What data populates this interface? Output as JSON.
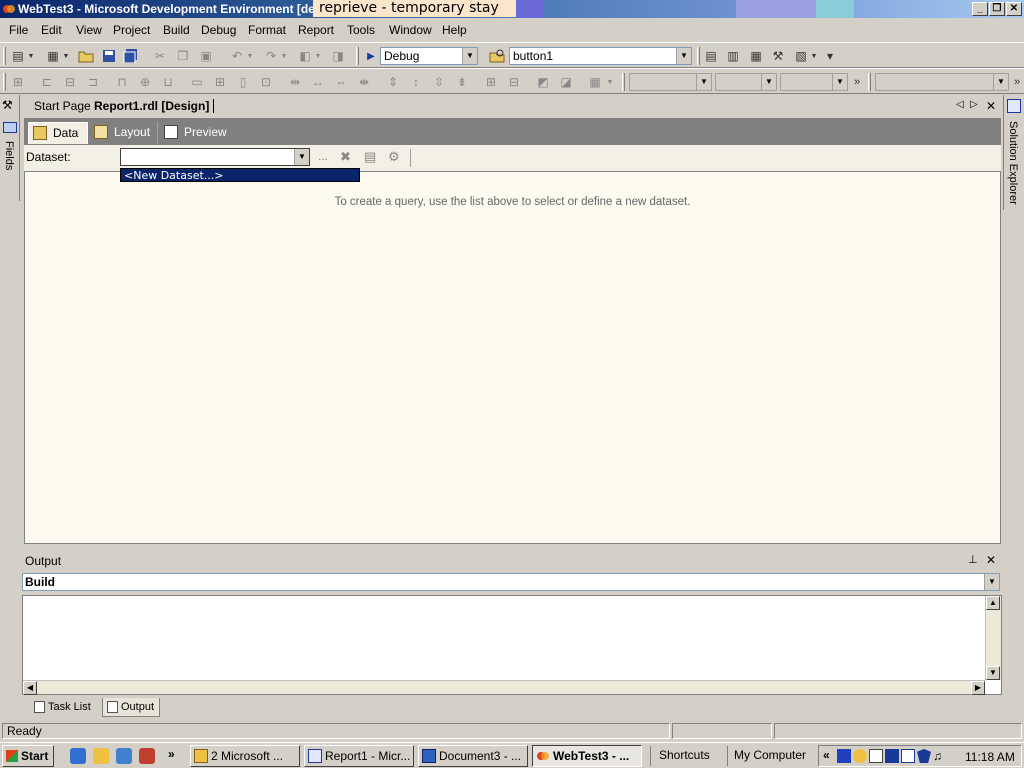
{
  "window": {
    "title": "WebTest3 - Microsoft Development Environment [de",
    "overlay_label": "reprieve - temporary stay",
    "controls": {
      "minimize": "_",
      "restore": "❐",
      "close": "✕"
    }
  },
  "menu": [
    "File",
    "Edit",
    "View",
    "Project",
    "Build",
    "Debug",
    "Format",
    "Report",
    "Tools",
    "Window",
    "Help"
  ],
  "toolbar": {
    "config": "Debug",
    "find_target": "button1",
    "overflow": "»"
  },
  "left_sidebar": {
    "label": "Fields",
    "icon": "toolbox-icon"
  },
  "right_sidebar": {
    "label": "Solution Explorer",
    "icon": "solution-explorer-icon"
  },
  "doc_tabs": [
    {
      "label": "Start Page"
    },
    {
      "label": "Report1.rdl [Design]"
    }
  ],
  "designer_tabs": [
    {
      "label": "Data",
      "icon": "data-icon"
    },
    {
      "label": "Layout",
      "icon": "layout-icon"
    },
    {
      "label": "Preview",
      "icon": "preview-icon"
    }
  ],
  "dataset": {
    "label": "Dataset:",
    "value": "",
    "ellipsis": "...",
    "dropdown_option": "<New Dataset...>"
  },
  "design_hint": "To create a query, use the list above to select or define a new dataset.",
  "output": {
    "title": "Output",
    "source": "Build"
  },
  "bottom_tabs": [
    {
      "label": "Task List"
    },
    {
      "label": "Output"
    }
  ],
  "status": {
    "text": "Ready"
  },
  "taskbar": {
    "start": "Start",
    "overflow": "»",
    "buttons": [
      "2 Microsoft ...",
      "Report1 - Micr...",
      "Document3 - ...",
      "WebTest3 - ..."
    ],
    "shortcuts": "Shortcuts",
    "my_computer": "My Computer",
    "tray_expand": "«",
    "clock": "11:18 AM"
  },
  "colors": {
    "title_start": "#0a246a",
    "design_bg": "#fdfaf0",
    "selection": "#0a246a"
  }
}
